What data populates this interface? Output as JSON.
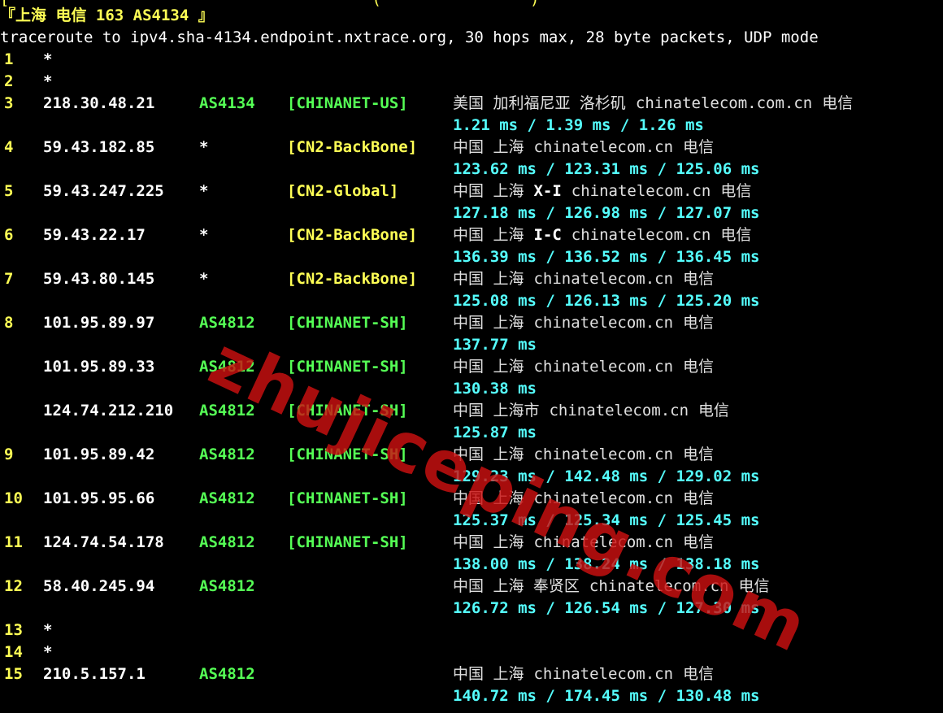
{
  "top_partial": "[                                       (                )",
  "header": {
    "location": "『上海 电信 163 AS4134 』",
    "command": "traceroute to ipv4.sha-4134.endpoint.nxtrace.org, 30 hops max, 28 byte packets, UDP mode"
  },
  "colors": {
    "background": "#000000",
    "hop": "#ffff55",
    "as": "#55ff55",
    "cn2": "#ffff55",
    "chinanet": "#55ff55",
    "rtt": "#55ffff",
    "text": "#ffffff",
    "watermark": "#cc1111"
  },
  "watermark": "zhujiceping.com",
  "hops": [
    {
      "hop": "1",
      "ip": "*"
    },
    {
      "hop": "2",
      "ip": "*"
    },
    {
      "hop": "3",
      "ip": "218.30.48.21",
      "as": "AS4134",
      "net": "[CHINANET-US]",
      "net_color": "chinanet",
      "geo": "美国 加利福尼亚 洛杉矶",
      "host": "chinatelecom.com.cn",
      "isp": "电信",
      "rtt": "1.21 ms / 1.39 ms / 1.26 ms"
    },
    {
      "hop": "4",
      "ip": "59.43.182.85",
      "as": "*",
      "net": "[CN2-BackBone]",
      "net_color": "cn2",
      "geo": "中国 上海",
      "host": "chinatelecom.cn",
      "isp": "电信",
      "rtt": "123.62 ms / 123.31 ms / 125.06 ms"
    },
    {
      "hop": "5",
      "ip": "59.43.247.225",
      "as": "*",
      "net": "[CN2-Global]",
      "net_color": "cn2",
      "geo": "中国 上海",
      "tag": "X-I",
      "host": "chinatelecom.cn",
      "isp": "电信",
      "rtt": "127.18 ms / 126.98 ms / 127.07 ms"
    },
    {
      "hop": "6",
      "ip": "59.43.22.17",
      "as": "*",
      "net": "[CN2-BackBone]",
      "net_color": "cn2",
      "geo": "中国 上海",
      "tag": "I-C",
      "host": "chinatelecom.cn",
      "isp": "电信",
      "rtt": "136.39 ms / 136.52 ms / 136.45 ms"
    },
    {
      "hop": "7",
      "ip": "59.43.80.145",
      "as": "*",
      "net": "[CN2-BackBone]",
      "net_color": "cn2",
      "geo": "中国 上海",
      "host": "chinatelecom.cn",
      "isp": "电信",
      "rtt": "125.08 ms / 126.13 ms / 125.20 ms"
    },
    {
      "hop": "8",
      "ip": "101.95.89.97",
      "as": "AS4812",
      "net": "[CHINANET-SH]",
      "net_color": "chinanet",
      "geo": "中国 上海",
      "host": "chinatelecom.cn",
      "isp": "电信",
      "rtt": "137.77 ms"
    },
    {
      "hop": "",
      "ip": "101.95.89.33",
      "as": "AS4812",
      "net": "[CHINANET-SH]",
      "net_color": "chinanet",
      "geo": "中国 上海",
      "host": "chinatelecom.cn",
      "isp": "电信",
      "rtt": "130.38 ms"
    },
    {
      "hop": "",
      "ip": "124.74.212.210",
      "as": "AS4812",
      "net": "[CHINANET-SH]",
      "net_color": "chinanet",
      "geo": "中国 上海市",
      "host": "chinatelecom.cn",
      "isp": "电信",
      "rtt": "125.87 ms"
    },
    {
      "hop": "9",
      "ip": "101.95.89.42",
      "as": "AS4812",
      "net": "[CHINANET-SH]",
      "net_color": "chinanet",
      "geo": "中国 上海",
      "host": "chinatelecom.cn",
      "isp": "电信",
      "rtt": "129.23 ms / 142.48 ms / 129.02 ms"
    },
    {
      "hop": "10",
      "ip": "101.95.95.66",
      "as": "AS4812",
      "net": "[CHINANET-SH]",
      "net_color": "chinanet",
      "geo": "中国 上海",
      "host": "chinatelecom.cn",
      "isp": "电信",
      "rtt": "125.37 ms / 125.34 ms / 125.45 ms"
    },
    {
      "hop": "11",
      "ip": "124.74.54.178",
      "as": "AS4812",
      "net": "[CHINANET-SH]",
      "net_color": "chinanet",
      "geo": "中国 上海",
      "host": "chinatelecom.cn",
      "isp": "电信",
      "rtt": "138.00 ms / 138.24 ms / 138.18 ms"
    },
    {
      "hop": "12",
      "ip": "58.40.245.94",
      "as": "AS4812",
      "net": "",
      "net_color": "chinanet",
      "geo": "中国 上海 奉贤区",
      "host": "chinatelecom.cn",
      "isp": "电信",
      "rtt": "126.72 ms / 126.54 ms / 127.30 ms"
    },
    {
      "hop": "13",
      "ip": "*"
    },
    {
      "hop": "14",
      "ip": "*"
    },
    {
      "hop": "15",
      "ip": "210.5.157.1",
      "as": "AS4812",
      "net": "",
      "net_color": "chinanet",
      "geo": "中国 上海",
      "host": "chinatelecom.cn",
      "isp": "电信",
      "rtt": "140.72 ms / 174.45 ms / 130.48 ms"
    }
  ]
}
